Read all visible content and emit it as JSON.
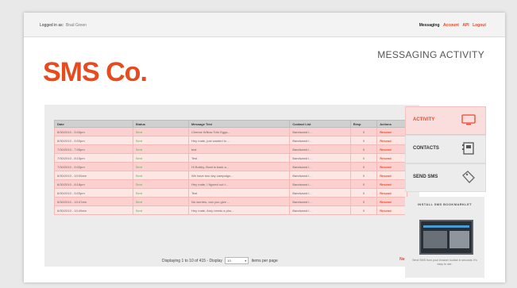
{
  "topbar": {
    "logged_in_label": "Logged in as:",
    "user_name": "Brad Green",
    "current_section": "Messaging",
    "links": [
      "Account",
      "API",
      "Logout"
    ]
  },
  "brand": {
    "logo": "SMS Co.",
    "accent_color": "#e8491d"
  },
  "page_title": "MESSAGING ACTIVITY",
  "table": {
    "headers": [
      "Date",
      "Status",
      "Message Text",
      "Contact List",
      "Resp",
      "Actions"
    ],
    "rows": [
      {
        "date": "8/30/2010 - 5:03pm",
        "status": "Sent",
        "message": "Cheese Willow Tofu Eggs...",
        "contact_list": "Bandwand l...",
        "resp": "0",
        "action": "Resend"
      },
      {
        "date": "8/30/2010 - 5:03pm",
        "status": "Sent",
        "message": "Hey mate, just wanted to ...",
        "contact_list": "Bandwand l...",
        "resp": "0",
        "action": "Resend"
      },
      {
        "date": "7/30/2010 - 7:05pm",
        "status": "Sent",
        "message": "test",
        "contact_list": "Bandwand l...",
        "resp": "0",
        "action": "Resend"
      },
      {
        "date": "7/30/2010 - 8:15pm",
        "status": "Sent",
        "message": "Test",
        "contact_list": "Bandwand l...",
        "resp": "0",
        "action": "Resend"
      },
      {
        "date": "7/30/2010 - 5:03pm",
        "status": "Sent",
        "message": "Hi Bobby, Bowl is back a...",
        "contact_list": "Bandwand l...",
        "resp": "0",
        "action": "Resend"
      },
      {
        "date": "6/30/2010 - 10:00am",
        "status": "Sent",
        "message": "We have two day campaign...",
        "contact_list": "Bandwand l...",
        "resp": "0",
        "action": "Resend"
      },
      {
        "date": "6/30/2010 - 8:18pm",
        "status": "Sent",
        "message": "Hey mate, I figured out t...",
        "contact_list": "Bandwand l...",
        "resp": "0",
        "action": "Resend"
      },
      {
        "date": "6/30/2010 - 5:03pm",
        "status": "Sent",
        "message": "Test",
        "contact_list": "Bandwand l...",
        "resp": "0",
        "action": "Resend"
      },
      {
        "date": "6/30/2010 - 10:47am",
        "status": "Sent",
        "message": "No worries, can you give ...",
        "contact_list": "Bandwand l...",
        "resp": "0",
        "action": "Resend"
      },
      {
        "date": "6/30/2010 - 10:49am",
        "status": "Sent",
        "message": "Hey mate, Amy needs a pho...",
        "contact_list": "Bandwand l...",
        "resp": "0",
        "action": "Resend"
      }
    ]
  },
  "pagination": {
    "display_text": "Displaying 1 to 10 of 415 - Display",
    "per_page_value": "10",
    "per_page_suffix": "items per page",
    "next_label": "Next"
  },
  "nav": {
    "activity": "ACTIVITY",
    "contacts": "CONTACTS",
    "send_sms": "SEND SMS"
  },
  "promo": {
    "title": "INSTALL SMS BOOKMARKLET",
    "text": "Send SMS from your browser toolbar in seconds. It's easy to use."
  },
  "colors": {
    "accent": "#e8472a",
    "row_pink": "#fbd0ce",
    "status_green": "#49b549"
  }
}
